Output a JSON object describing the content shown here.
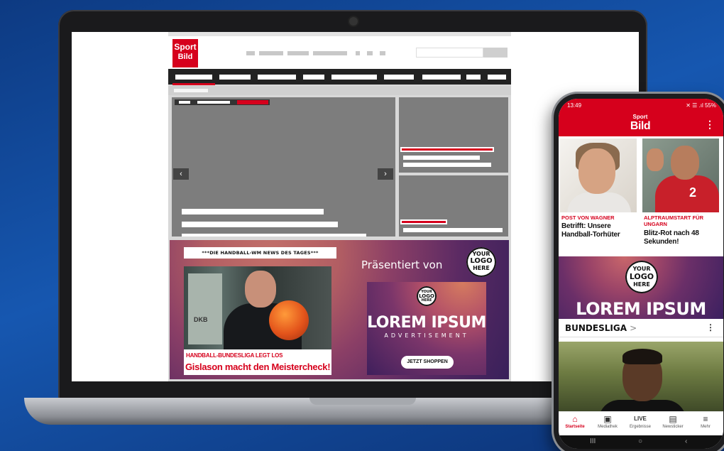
{
  "laptop": {
    "site_logo": {
      "line1": "Sport",
      "line2": "Bild"
    },
    "hero_prev": "‹",
    "hero_next": "›",
    "ad": {
      "headline": "***DIE HANDBALL-WM NEWS DES TAGES***",
      "article_kicker": "HANDBALL-BUNDESLIGA LEGT LOS",
      "article_title": "Gislason macht den Meistercheck!",
      "photo_sign": "DKB",
      "presented_by": "Präsentiert von",
      "logo_text": [
        "YOUR",
        "LOGO",
        "HERE"
      ],
      "lorem": "LOREM IPSUM",
      "advertisement": "ADVERTISEMENT",
      "cta": "JETZT SHOPPEN"
    }
  },
  "phone": {
    "status_time": "13:49",
    "status_right": "✕ ☰ .ıl 55%",
    "app_logo": {
      "line1": "Sport",
      "line2": "Bild"
    },
    "menu_icon": "⋮",
    "stories": [
      {
        "kicker": "POST VON WAGNER",
        "title_line1": "Betrifft: Unsere",
        "title_line2": "Handball-Torhüter"
      },
      {
        "kicker_line1": "ALPTRAUMSTART FÜR",
        "kicker_line2": "UNGARN",
        "title_line1": "Blitz-Rot nach 48",
        "title_line2": "Sekunden!",
        "jersey_number": "2"
      }
    ],
    "ad_logo": [
      "YOUR",
      "LOGO",
      "HERE"
    ],
    "ad_lorem": "LOREM IPSUM",
    "section_title": "BUNDESLIGA",
    "section_chevron": ">",
    "section_more": "⋮",
    "tabs": [
      {
        "label": "Startseite",
        "icon": "⌂"
      },
      {
        "label": "Mediathek",
        "icon": "▣"
      },
      {
        "label": "Ergebnisse",
        "icon": "LIVE"
      },
      {
        "label": "Newsticker",
        "icon": "▤"
      },
      {
        "label": "Mehr",
        "icon": "≡"
      }
    ],
    "system_nav": [
      "III",
      "○",
      "‹"
    ]
  },
  "colors": {
    "brand_red": "#d6001c",
    "dark": "#222222",
    "background_blue": "#1657b0"
  }
}
